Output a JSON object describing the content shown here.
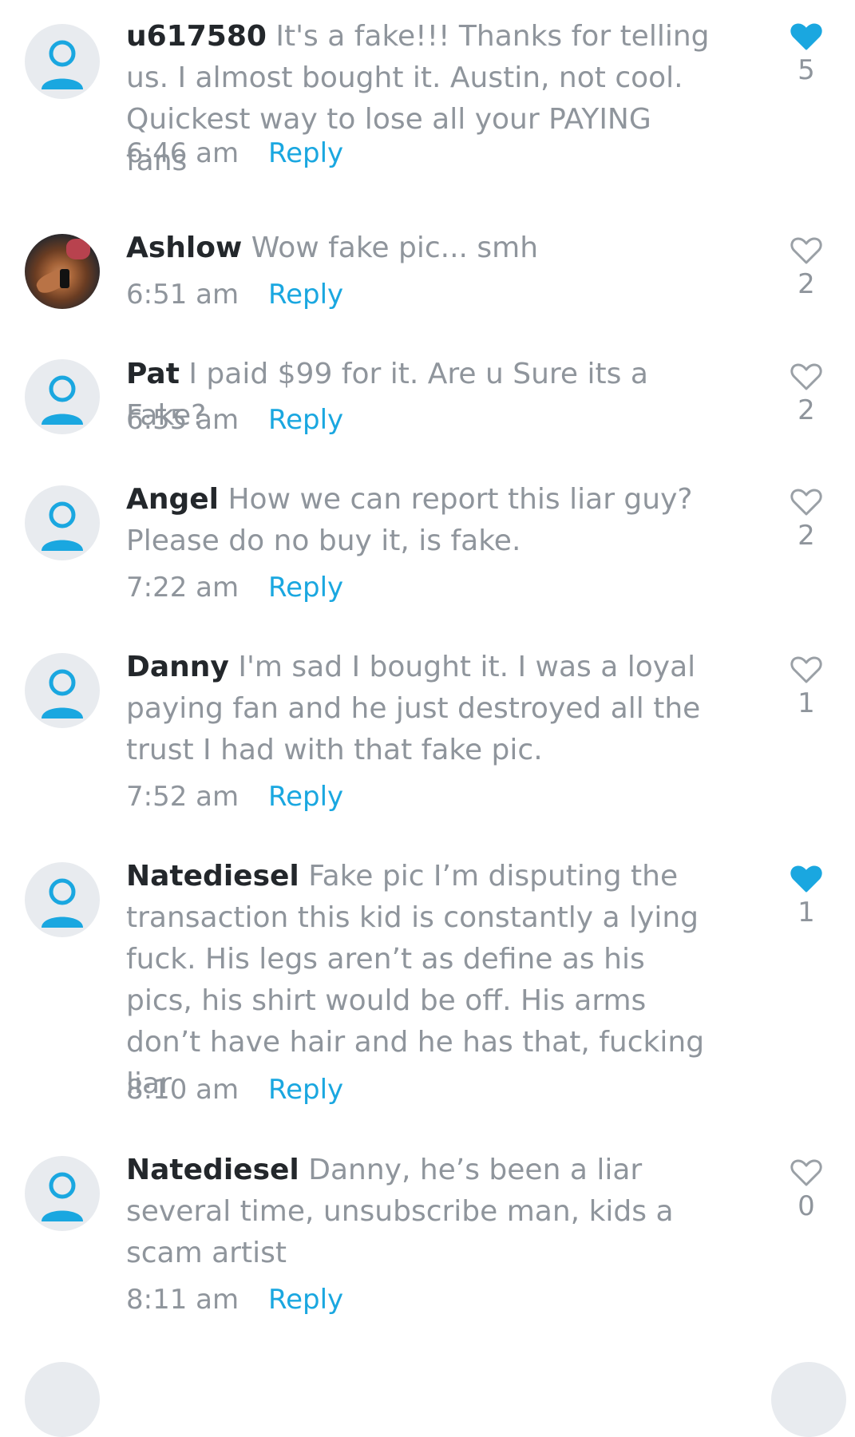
{
  "comments": [
    {
      "author": "u617580",
      "text": "It's a fake!!! Thanks for telling us. I almost bought it. Austin, not cool. Quickest way to lose all your PAYING fans",
      "time": "6:46 am",
      "reply": "Reply",
      "likes": "5",
      "liked": true,
      "avatar": "default-avatar"
    },
    {
      "author": "Ashlow",
      "text": "Wow fake pic... smh",
      "time": "6:51 am",
      "reply": "Reply",
      "likes": "2",
      "liked": false,
      "avatar": "photo-avatar"
    },
    {
      "author": "Pat",
      "text": "I paid $99 for it. Are u Sure its a Fake?",
      "time": "6:55 am",
      "reply": "Reply",
      "likes": "2",
      "liked": false,
      "avatar": "default-avatar"
    },
    {
      "author": "Angel",
      "text": "How we can report this liar guy? Please do no buy it, is fake.",
      "time": "7:22 am",
      "reply": "Reply",
      "likes": "2",
      "liked": false,
      "avatar": "default-avatar"
    },
    {
      "author": "Danny",
      "text": "I'm sad I bought it. I was a loyal paying fan and he just destroyed all the trust I had with that fake pic.",
      "time": "7:52 am",
      "reply": "Reply",
      "likes": "1",
      "liked": false,
      "avatar": "default-avatar"
    },
    {
      "author": "Natediesel",
      "text": "Fake pic I’m disputing the transaction this kid is constantly a lying fuck. His legs aren’t as define as his pics, his shirt would be off. His arms don’t have hair and he has that, fucking liar",
      "time": "8:10 am",
      "reply": "Reply",
      "likes": "1",
      "liked": true,
      "avatar": "default-avatar"
    },
    {
      "author": "Natediesel",
      "text": "Danny, he’s been a liar several time, unsubscribe man, kids a scam artist",
      "time": "8:11 am",
      "reply": "Reply",
      "likes": "0",
      "liked": false,
      "avatar": "default-avatar"
    }
  ],
  "colors": {
    "accent": "#1aa7e0",
    "like_filled": "#1aa7e0",
    "like_outline": "#9aa0a6",
    "author": "#23272b",
    "body_text": "#8f959c",
    "avatar_bg": "#e8ebef"
  }
}
